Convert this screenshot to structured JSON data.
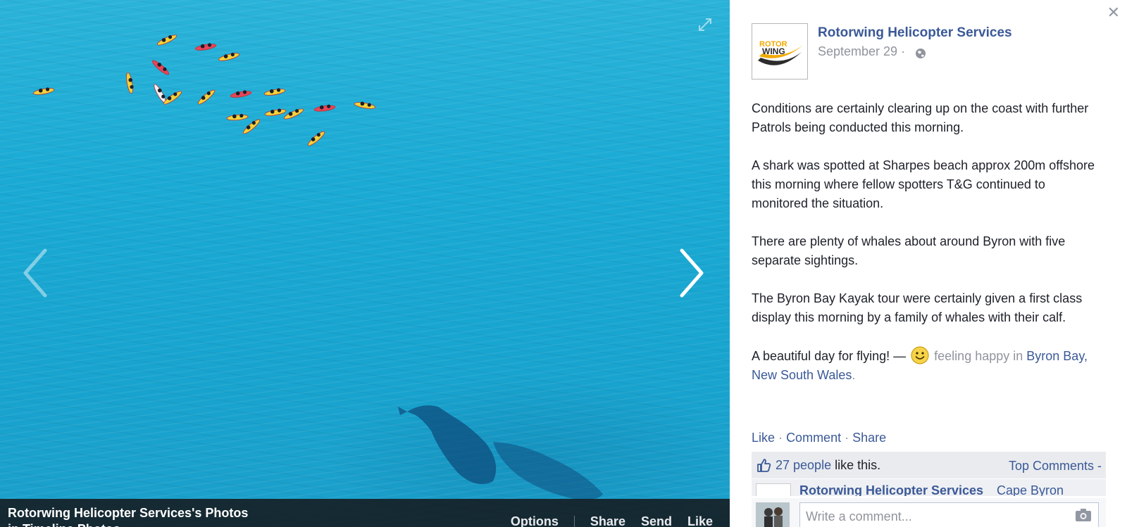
{
  "viewer": {
    "album_title": "Rotorwing Helicopter Services's Photos",
    "album_subtitle": "in Timeline Photos",
    "actions": [
      "Options",
      "Share",
      "Send",
      "Like"
    ]
  },
  "post": {
    "page_name": "Rotorwing Helicopter Services",
    "logo_text_top": "ROTOR",
    "logo_text_bottom": "WING",
    "date": "September 29",
    "date_separator": "·",
    "paragraphs": [
      "Conditions are certainly clearing up on the coast with further Patrols being conducted this morning.",
      "A shark was spotted at Sharpes beach approx 200m offshore this morning where fellow spotters T&G continued to monitored the situation.",
      "There are plenty of whales about around Byron with five separate sightings.",
      "The Byron Bay Kayak tour were certainly given a first class display this morning by a family of whales with their calf."
    ],
    "closing_text": "A beautiful day for flying! —",
    "feeling_text": "feeling happy in",
    "location": "Byron Bay, New South Wales",
    "location_suffix": "."
  },
  "actions": {
    "like": "Like",
    "comment": "Comment",
    "share": "Share",
    "separator": "·"
  },
  "likes": {
    "people": "27 people",
    "suffix": "like this.",
    "top_comments": "Top Comments -"
  },
  "comment_preview": {
    "author": "Rotorwing Helicopter Services",
    "text": "Cape Byron"
  },
  "compose": {
    "placeholder": "Write a comment..."
  },
  "colors": {
    "link": "#3b5998",
    "muted": "#90949c",
    "sea": "#1aaad4",
    "logo_orange": "#f2a900"
  },
  "icons": [
    "expand-icon",
    "prev-arrow-icon",
    "next-arrow-icon",
    "close-icon",
    "globe-icon",
    "smiley-icon",
    "thumbs-up-icon",
    "camera-icon"
  ]
}
